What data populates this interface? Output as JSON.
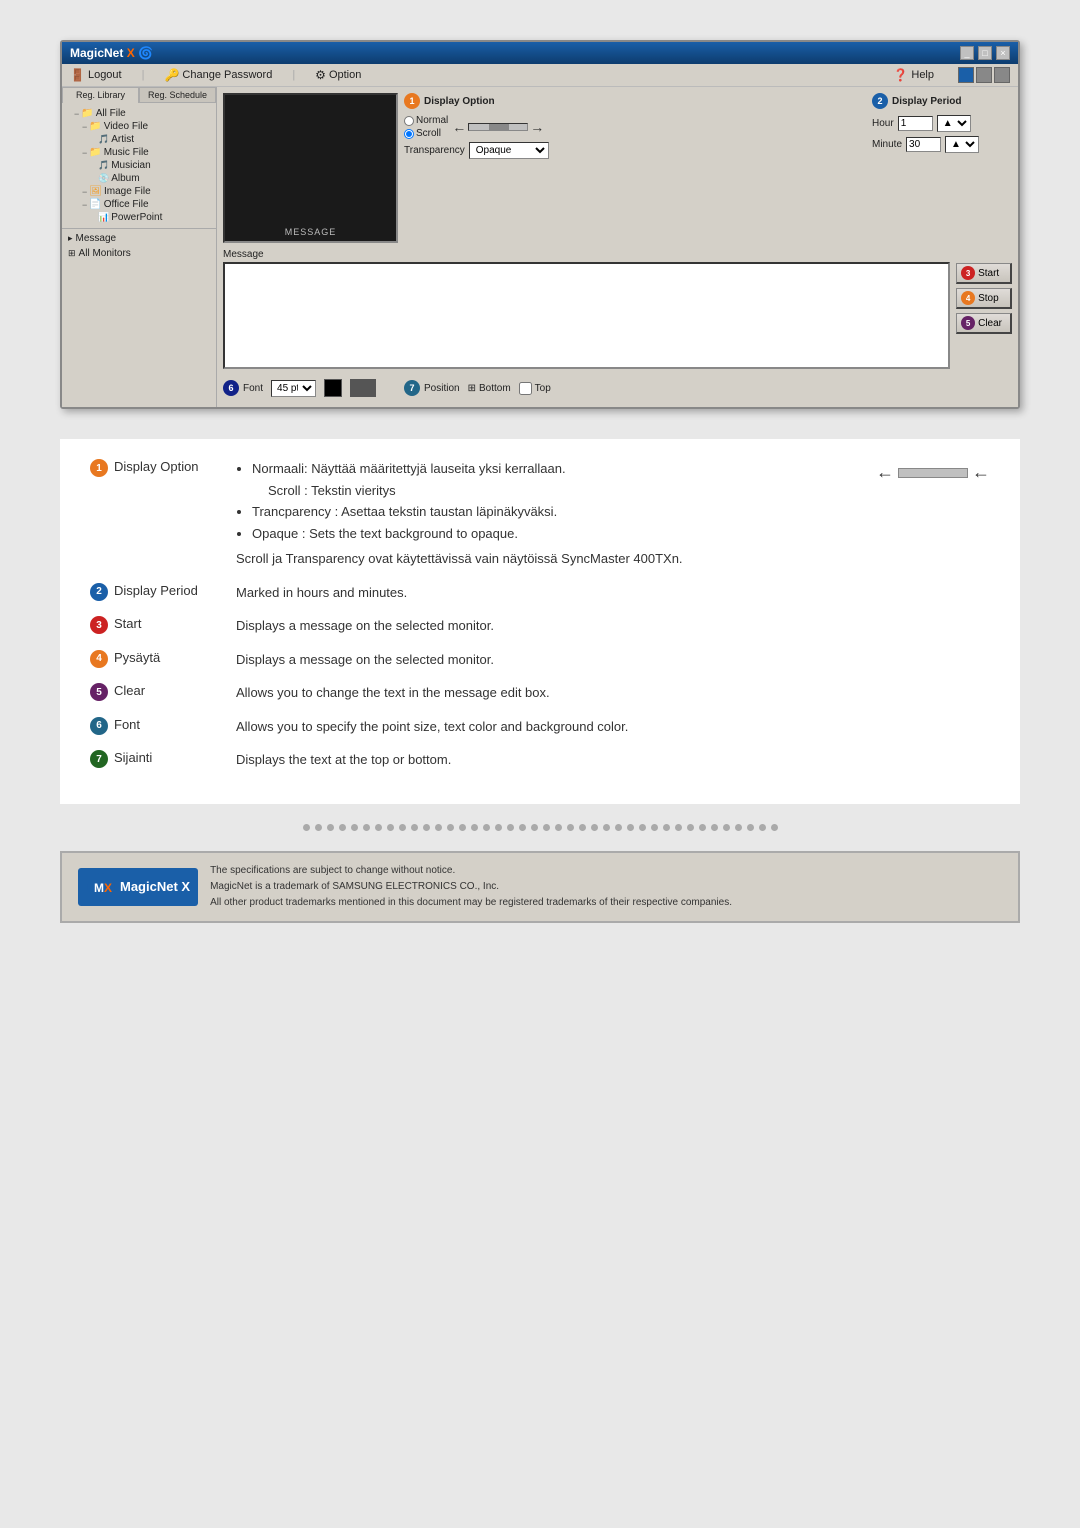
{
  "app": {
    "title": "MagicNet X",
    "logo_x": "X",
    "menu": {
      "logout": "Logout",
      "change_password": "Change Password",
      "option": "Option",
      "help": "Help"
    },
    "sidebar": {
      "tab1": "Reg. Library",
      "tab2": "Reg. Schedule",
      "tree": [
        {
          "label": "All File",
          "indent": 1,
          "type": "folder"
        },
        {
          "label": "Video File",
          "indent": 2,
          "type": "folder"
        },
        {
          "label": "Artist",
          "indent": 3,
          "type": "file"
        },
        {
          "label": "Music File",
          "indent": 2,
          "type": "folder"
        },
        {
          "label": "Musician",
          "indent": 3,
          "type": "file"
        },
        {
          "label": "Album",
          "indent": 3,
          "type": "file"
        },
        {
          "label": "Image File",
          "indent": 2,
          "type": "folder"
        },
        {
          "label": "Office File",
          "indent": 2,
          "type": "folder"
        },
        {
          "label": "PowerPoint",
          "indent": 3,
          "type": "file"
        }
      ],
      "message": "Message",
      "all_monitors": "All Monitors"
    },
    "display_options": {
      "badge": "1",
      "title": "Display Option",
      "transparency_label": "Transparency",
      "transparency_value": "Opaque",
      "scroll_label": "Scroll"
    },
    "display_period": {
      "badge": "2",
      "title": "Display Period",
      "hour_label": "Hour",
      "hour_value": "1",
      "minute_label": "Minute",
      "minute_value": "30"
    },
    "message_area": {
      "label": "Message",
      "start_badge": "3",
      "start_label": "Start",
      "stop_badge": "4",
      "stop_label": "Stop",
      "clear_badge": "5",
      "clear_label": "Clear"
    },
    "font_area": {
      "badge": "6",
      "title": "Font",
      "size_value": "45 pt",
      "position_badge": "7",
      "position_title": "Position",
      "bottom_label": "Bottom",
      "top_label": "Top"
    }
  },
  "descriptions": [
    {
      "badge": "1",
      "badge_color": "#e87820",
      "term": "Display Option",
      "definition_lines": [
        "• Normaali: Näyttää määritettyjä lauseita yksi kerrallaan.",
        "  Scroll : Tekstin vieritys",
        "• Trancparency : Asettaa tekstin taustan läpinäkyväksi.",
        "• Opaque : Sets the text background to opaque.",
        "",
        "Scroll ja Transparency ovat käytettävissä vain näytöissä SyncMaster 400TXn."
      ],
      "has_scroll_graphic": true
    },
    {
      "badge": "2",
      "badge_color": "#1a5fa8",
      "term": "Display Period",
      "definition": "Marked in hours and minutes.",
      "has_scroll_graphic": false
    },
    {
      "badge": "3",
      "badge_color": "#cc2222",
      "term": "Start",
      "definition": "Displays a message on the selected monitor.",
      "has_scroll_graphic": false
    },
    {
      "badge": "4",
      "badge_color": "#e87820",
      "term": "Pysäytä",
      "definition": "Displays a message on the selected monitor.",
      "has_scroll_graphic": false
    },
    {
      "badge": "5",
      "badge_color": "#cc2222",
      "term": "Clear",
      "definition": "Allows you to change the text in the message edit box.",
      "has_scroll_graphic": false
    },
    {
      "badge": "6",
      "badge_color": "#226688",
      "term": "Font",
      "definition": "Allows you to specify the point size, text color and background color.",
      "has_scroll_graphic": false
    },
    {
      "badge": "7",
      "badge_color": "#226622",
      "term": "Sijainti",
      "definition": "Displays the text at the top or bottom.",
      "has_scroll_graphic": false
    }
  ],
  "footer": {
    "logo": "MagicNet X",
    "line1": "The specifications are subject to change without notice.",
    "line2": "MagicNet is a trademark of SAMSUNG ELECTRONICS CO., Inc.",
    "line3": "All other product trademarks mentioned in this document may be registered trademarks of their respective companies."
  }
}
